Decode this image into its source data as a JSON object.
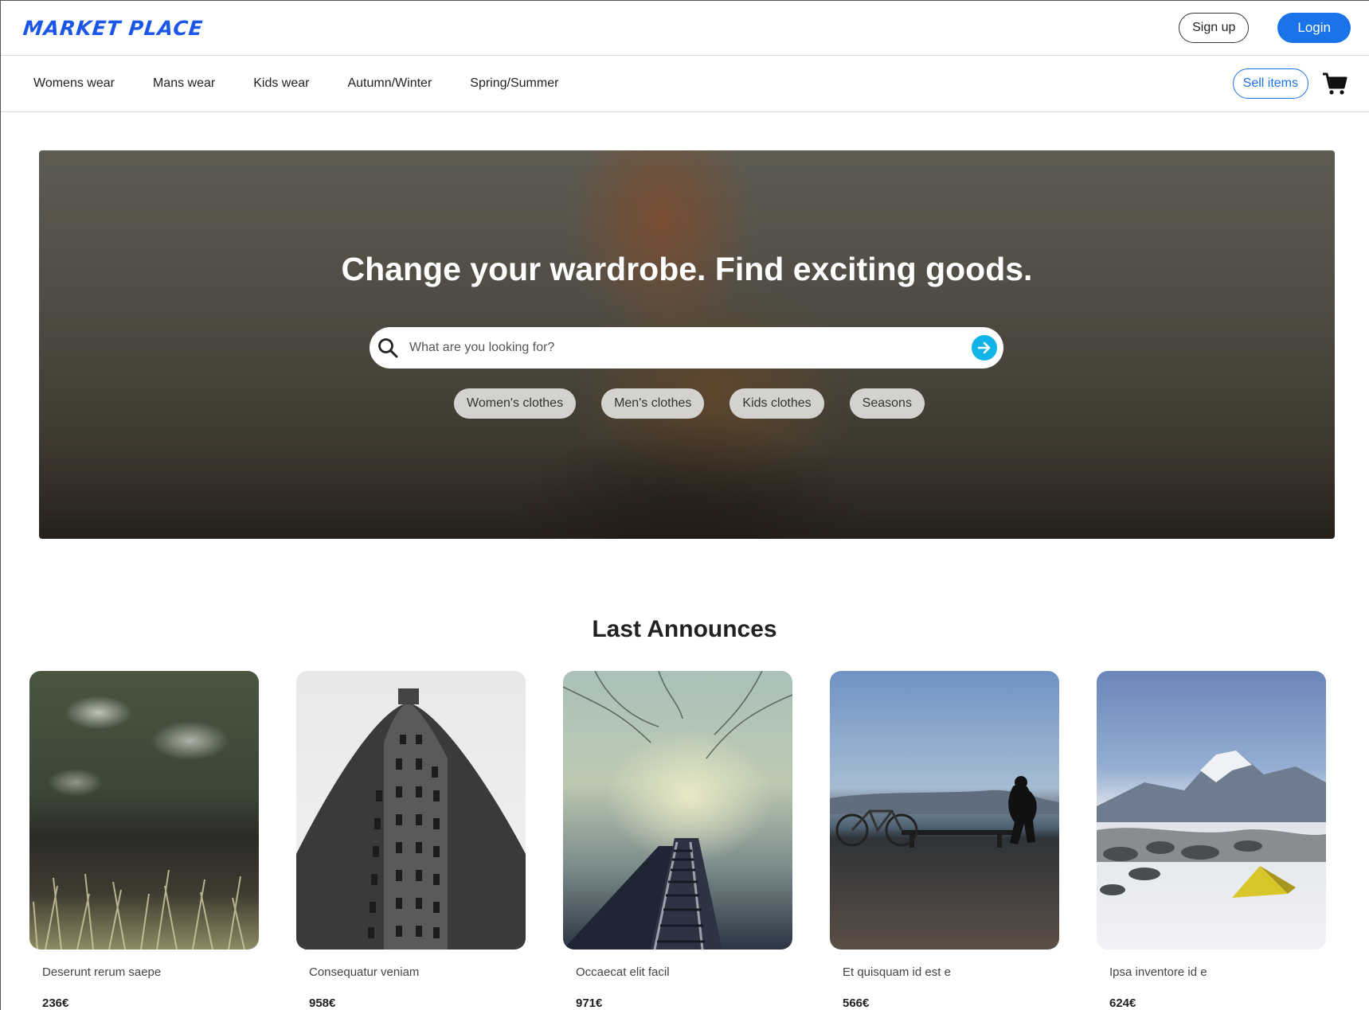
{
  "header": {
    "logo": "MARKET PLACE",
    "signup_label": "Sign up",
    "login_label": "Login"
  },
  "nav": {
    "items": [
      "Womens wear",
      "Mans wear",
      "Kids wear",
      "Autumn/Winter",
      "Spring/Summer"
    ],
    "sell_label": "Sell items",
    "cart_icon": "shopping-cart-icon"
  },
  "hero": {
    "title": "Change your wardrobe. Find exciting goods.",
    "search_placeholder": "What are you looking for?",
    "search_icon": "search-icon",
    "submit_icon": "arrow-right-icon",
    "chips": [
      "Women's clothes",
      "Men's clothes",
      "Kids clothes",
      "Seasons"
    ]
  },
  "announces": {
    "title": "Last Announces",
    "items": [
      {
        "title": "Deserunt rerum saepe",
        "price": "236€"
      },
      {
        "title": "Consequatur veniam",
        "price": "958€"
      },
      {
        "title": "Occaecat elit facil",
        "price": "971€"
      },
      {
        "title": "Et quisquam id est e",
        "price": "566€"
      },
      {
        "title": "Ipsa inventore id e",
        "price": "624€"
      }
    ]
  },
  "colors": {
    "brand_blue": "#1a73e8",
    "submit_cyan": "#11b4e6"
  }
}
